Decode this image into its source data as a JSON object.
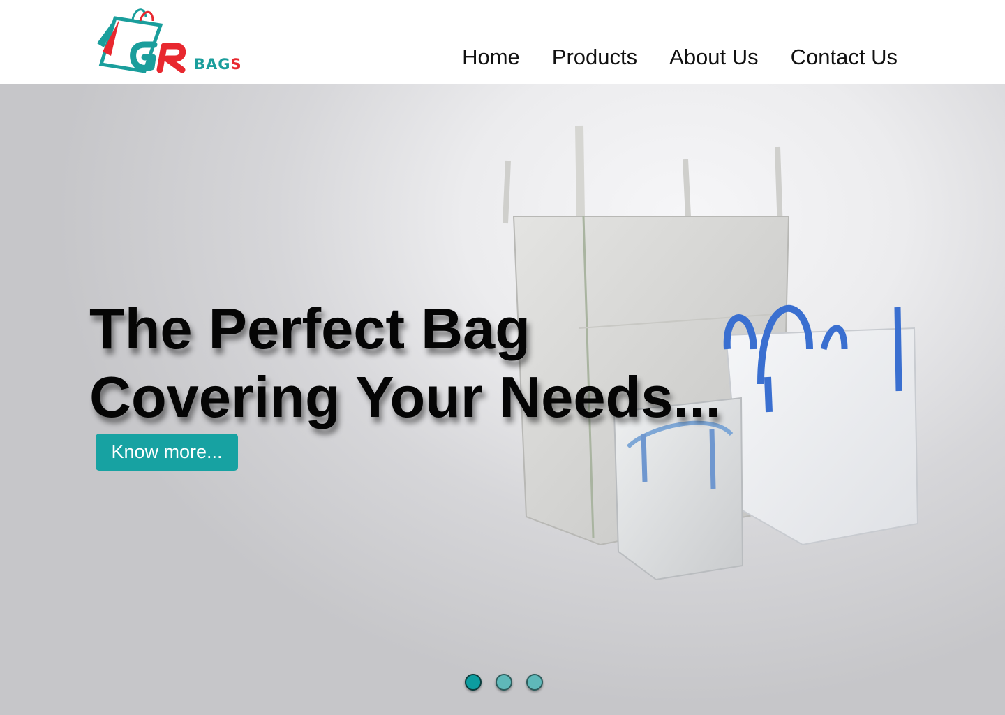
{
  "brand": {
    "logo_letters": "GR",
    "logo_word_part1": "BAG",
    "logo_word_part2": "S"
  },
  "nav": {
    "items": [
      {
        "label": "Home"
      },
      {
        "label": "Products"
      },
      {
        "label": "About Us"
      },
      {
        "label": "Contact Us"
      }
    ]
  },
  "hero": {
    "headline_line1": "The Perfect Bag",
    "headline_line2": "Covering Your Needs...",
    "cta_label": "Know more...",
    "slides_total": 3,
    "active_slide": 1
  },
  "colors": {
    "accent": "#17a2a2",
    "logo_teal": "#1a9e9c",
    "logo_red": "#e8282f",
    "bag_handle_blue": "#3a6fd0"
  }
}
